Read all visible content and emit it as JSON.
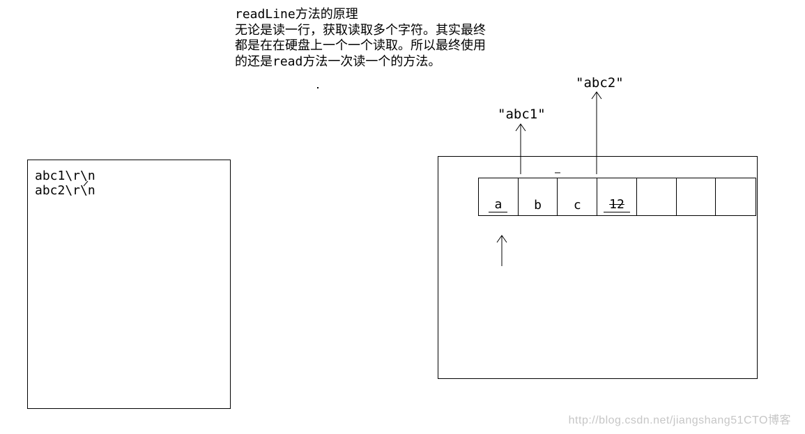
{
  "title": {
    "l1": "readLine方法的原理",
    "l2": "无论是读一行，获取读取多个字符。其实最终",
    "l3": "都是在在硬盘上一个一个读取。所以最终使用",
    "l4": "的还是read方法一次读一个的方法。"
  },
  "leftBox": {
    "line1": "abc1\\r\\n",
    "line2": "abc2\\r\\n"
  },
  "buffer": {
    "c0": "a",
    "c1": "b",
    "c2": "c",
    "c3": "12",
    "c4": "",
    "c5": "",
    "c6": ""
  },
  "labels": {
    "out1": "\"abc1\"",
    "out2": "\"abc2\""
  },
  "watermark": "http://blog.csdn.net/jiangshang51CTO博客"
}
